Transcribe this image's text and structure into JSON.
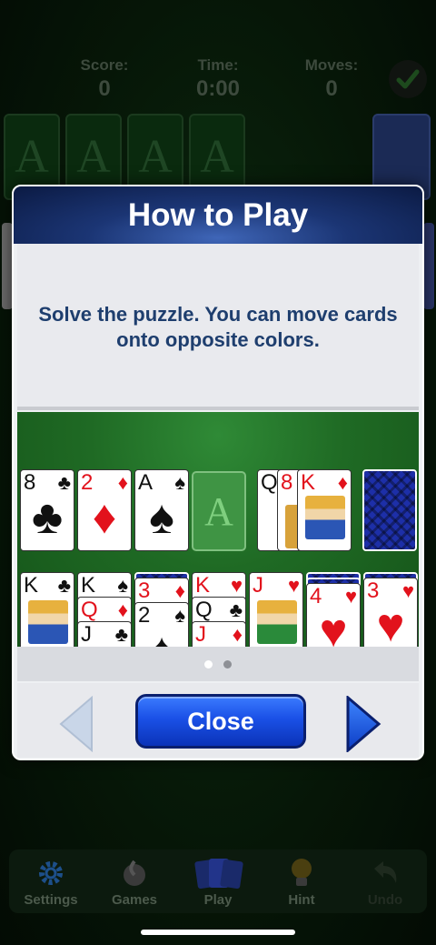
{
  "stats": {
    "score_label": "Score:",
    "score_value": "0",
    "time_label": "Time:",
    "time_value": "0:00",
    "moves_label": "Moves:",
    "moves_value": "0"
  },
  "foundation_letter": "A",
  "modal": {
    "title": "How to Play",
    "instruction": "Solve the puzzle. You can move cards onto opposite colors.",
    "close_label": "Close",
    "page_dots": 2,
    "active_page": 1
  },
  "demo": {
    "top_row": [
      {
        "rank": "8",
        "suit": "♣",
        "color": "black"
      },
      {
        "rank": "2",
        "suit": "♦",
        "color": "red"
      },
      {
        "rank": "A",
        "suit": "♠",
        "color": "black"
      }
    ],
    "foundation_letter": "A",
    "waste": [
      {
        "rank": "Q",
        "suit": "",
        "color": "black"
      },
      {
        "rank": "8",
        "suit": "",
        "color": "red"
      },
      {
        "rank": "K",
        "suit": "♦",
        "color": "red"
      }
    ],
    "tableau": [
      [
        {
          "rank": "K",
          "suit": "♣",
          "color": "black"
        }
      ],
      [
        {
          "rank": "K",
          "suit": "♠",
          "color": "black"
        },
        {
          "rank": "Q",
          "suit": "♦",
          "color": "red"
        },
        {
          "rank": "J",
          "suit": "♣",
          "color": "black"
        }
      ],
      [
        {
          "rank": "3",
          "suit": "♦",
          "color": "red"
        },
        {
          "rank": "2",
          "suit": "♠",
          "color": "black"
        }
      ],
      [
        {
          "rank": "K",
          "suit": "♥",
          "color": "red"
        },
        {
          "rank": "Q",
          "suit": "♣",
          "color": "black"
        },
        {
          "rank": "J",
          "suit": "♦",
          "color": "red"
        }
      ],
      [
        {
          "rank": "J",
          "suit": "♥",
          "color": "red"
        }
      ],
      [
        {
          "rank": "4",
          "suit": "♥",
          "color": "red"
        }
      ],
      [
        {
          "rank": "3",
          "suit": "♥",
          "color": "red"
        }
      ]
    ]
  },
  "bottom_nav": [
    {
      "label": "Settings",
      "icon": "gear-icon"
    },
    {
      "label": "Games",
      "icon": "games-icon"
    },
    {
      "label": "Play",
      "icon": "cards-icon"
    },
    {
      "label": "Hint",
      "icon": "lightbulb-icon"
    },
    {
      "label": "Undo",
      "icon": "undo-icon"
    }
  ],
  "colors": {
    "header_blue": "#1b3574",
    "close_blue": "#1a50e6",
    "felt_green": "#1f6a24",
    "instruction_text": "#1e3e6e"
  }
}
